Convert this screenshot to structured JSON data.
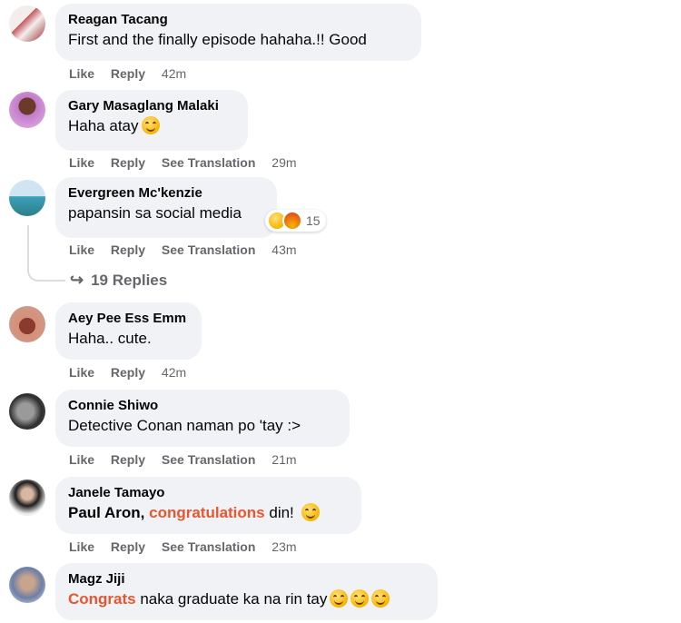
{
  "comments": [
    {
      "author": "Reagan Tacang",
      "pre": "First and the finally episode hahaha.!! Good",
      "actions": [
        "Like",
        "Reply"
      ],
      "time": "42m"
    },
    {
      "author": "Gary Masaglang Malaki",
      "pre": "Haha atay",
      "emoji": "laughing-emoji",
      "actions": [
        "Like",
        "Reply",
        "See Translation"
      ],
      "time": "29m"
    },
    {
      "author": "Evergreen Mc'kenzie",
      "pre": "papansin sa social media",
      "reactions": {
        "count": "15",
        "icons": [
          "haha",
          "angry"
        ]
      },
      "actions": [
        "Like",
        "Reply",
        "See Translation"
      ],
      "time": "43m",
      "replies_label": "19 Replies"
    },
    {
      "author": "Aey Pee Ess Emm",
      "pre": "Haha.. cute.",
      "actions": [
        "Like",
        "Reply"
      ],
      "time": "42m"
    },
    {
      "author": "Connie Shiwo",
      "pre": "Detective Conan naman po 'tay :>",
      "actions": [
        "Like",
        "Reply",
        "See Translation"
      ],
      "time": "21m"
    },
    {
      "author": "Janele Tamayo",
      "mention": "Paul Aron,",
      "highlight": "congratulations",
      "post": " din!",
      "emoji": "grinning-emoji",
      "actions": [
        "Like",
        "Reply",
        "See Translation"
      ],
      "time": "23m"
    },
    {
      "author": "Magz Jiji",
      "highlight": "Congrats",
      "post": " naka graduate ka na rin tay",
      "emoji_count": 3
    }
  ],
  "colors": {
    "bubble": "#f0f2f5",
    "highlight": "#e8562f",
    "muted": "#65676b"
  }
}
